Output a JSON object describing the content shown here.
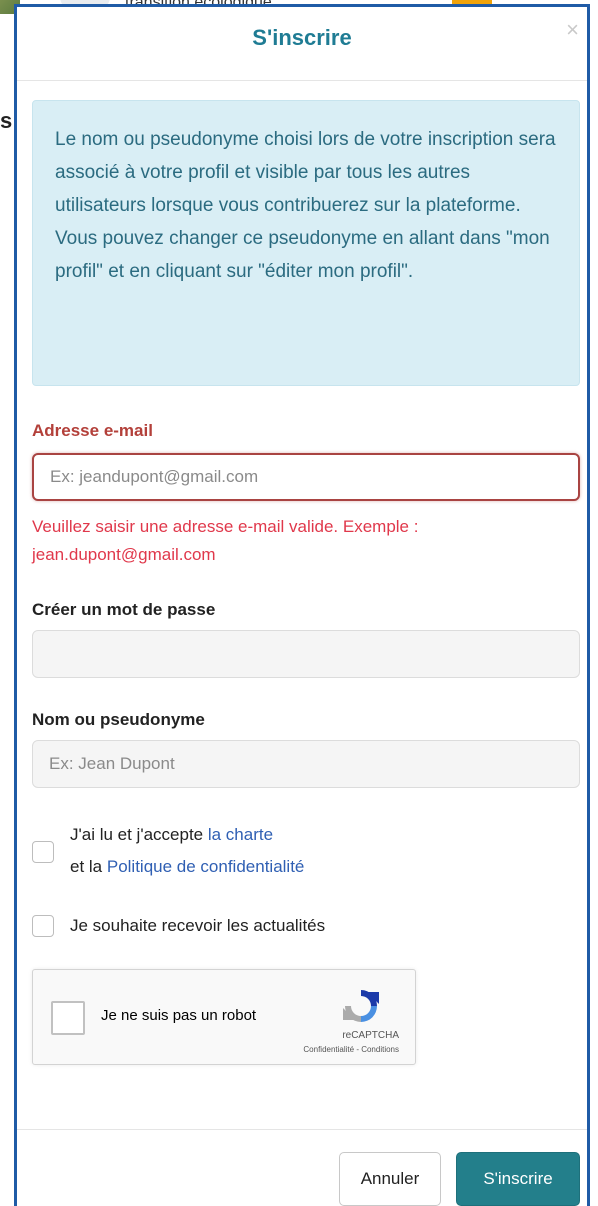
{
  "background": {
    "header_text": "transition écologique",
    "side_letter": "s"
  },
  "modal": {
    "title": "S'inscrire",
    "close": "×",
    "info": {
      "paragraph1": "Le nom ou pseudonyme choisi lors de votre inscription sera associé à votre profil et visible par tous les autres utilisateurs lorsque vous contribuerez sur la plateforme.",
      "paragraph2": "Vous pouvez changer ce pseudonyme en allant dans \"mon profil\" et en cliquant sur \"éditer mon profil\"."
    },
    "email": {
      "label": "Adresse e-mail",
      "placeholder": "Ex: jeandupont@gmail.com",
      "value": "",
      "error": "Veuillez saisir une adresse e-mail valide. Exemple : jean.dupont@gmail.com"
    },
    "password": {
      "label": "Créer un mot de passe",
      "placeholder": "",
      "value": ""
    },
    "pseudonym": {
      "label": "Nom ou pseudonyme",
      "placeholder": "Ex: Jean Dupont",
      "value": ""
    },
    "terms": {
      "text_before": "J'ai lu et j'accepte ",
      "charter_link": "la charte",
      "text_middle": "et la ",
      "privacy_link": "Politique de confidentialité",
      "checked": false
    },
    "news": {
      "label": "Je souhaite recevoir les actualités",
      "checked": false
    },
    "recaptcha": {
      "label": "Je ne suis pas un robot",
      "brand": "reCAPTCHA",
      "links": "Confidentialité - Conditions"
    },
    "buttons": {
      "cancel": "Annuler",
      "submit": "S'inscrire"
    }
  },
  "colors": {
    "title": "#1f7c94",
    "info_bg": "#d9eef5",
    "info_text": "#2b6b80",
    "error": "#e0384b",
    "primary_button": "#237f8b",
    "link": "#2f5fb3",
    "modal_border": "#1f5ba6"
  }
}
